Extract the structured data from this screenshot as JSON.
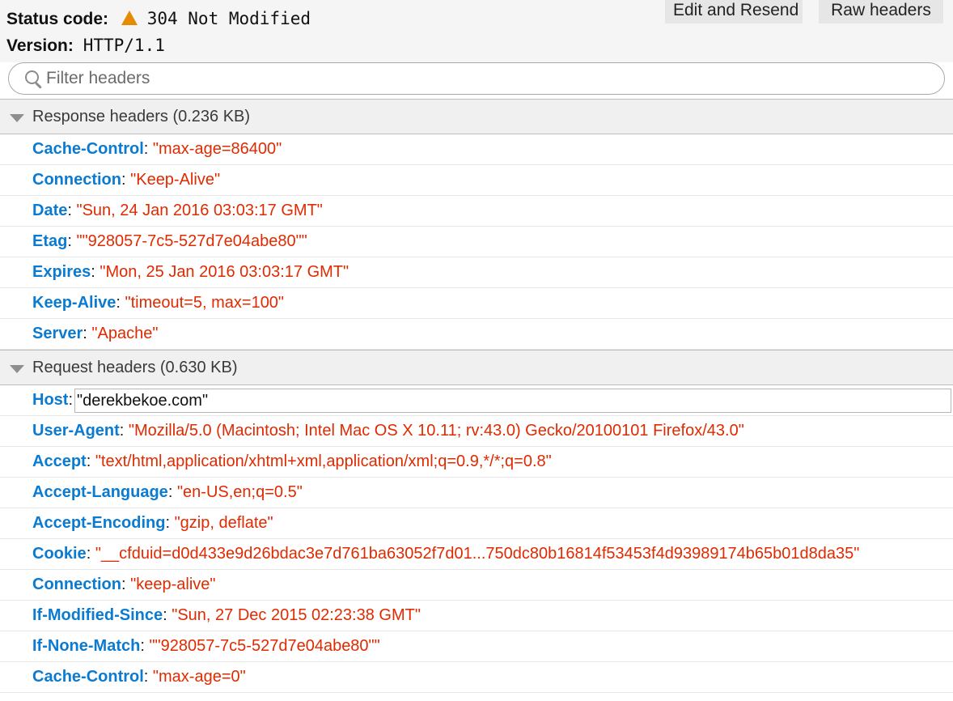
{
  "status": {
    "label": "Status code:",
    "value": "304 Not Modified",
    "icon": "warning-triangle-icon",
    "icon_color": "#e68a00"
  },
  "version": {
    "label": "Version:",
    "value": "HTTP/1.1"
  },
  "buttons": {
    "edit_resend": "Edit and Resend",
    "raw_headers": "Raw headers"
  },
  "filter": {
    "placeholder": "Filter headers",
    "value": ""
  },
  "colors": {
    "header_name": "#0a7bd1",
    "header_value": "#e02a00"
  },
  "response": {
    "title": "Response headers (0.236 KB)",
    "headers": [
      {
        "name": "Cache-Control",
        "value": "\"max-age=86400\""
      },
      {
        "name": "Connection",
        "value": "\"Keep-Alive\""
      },
      {
        "name": "Date",
        "value": "\"Sun, 24 Jan 2016 03:03:17 GMT\""
      },
      {
        "name": "Etag",
        "value": "\"\"928057-7c5-527d7e04abe80\"\""
      },
      {
        "name": "Expires",
        "value": "\"Mon, 25 Jan 2016 03:03:17 GMT\""
      },
      {
        "name": "Keep-Alive",
        "value": "\"timeout=5, max=100\""
      },
      {
        "name": "Server",
        "value": "\"Apache\""
      }
    ]
  },
  "request": {
    "title": "Request headers (0.630 KB)",
    "headers": [
      {
        "name": "Host",
        "value": "\"derekbekoe.com\"",
        "editing": true
      },
      {
        "name": "User-Agent",
        "value": "\"Mozilla/5.0 (Macintosh; Intel Mac OS X 10.11; rv:43.0) Gecko/20100101 Firefox/43.0\""
      },
      {
        "name": "Accept",
        "value": "\"text/html,application/xhtml+xml,application/xml;q=0.9,*/*;q=0.8\""
      },
      {
        "name": "Accept-Language",
        "value": "\"en-US,en;q=0.5\""
      },
      {
        "name": "Accept-Encoding",
        "value": "\"gzip, deflate\""
      },
      {
        "name": "Cookie",
        "value": "\"__cfduid=d0d433e9d26bdac3e7d761ba63052f7d01...750dc80b16814f53453f4d93989174b65b01d8da35\""
      },
      {
        "name": "Connection",
        "value": "\"keep-alive\""
      },
      {
        "name": "If-Modified-Since",
        "value": "\"Sun, 27 Dec 2015 02:23:38 GMT\""
      },
      {
        "name": "If-None-Match",
        "value": "\"\"928057-7c5-527d7e04abe80\"\""
      },
      {
        "name": "Cache-Control",
        "value": "\"max-age=0\""
      }
    ]
  }
}
